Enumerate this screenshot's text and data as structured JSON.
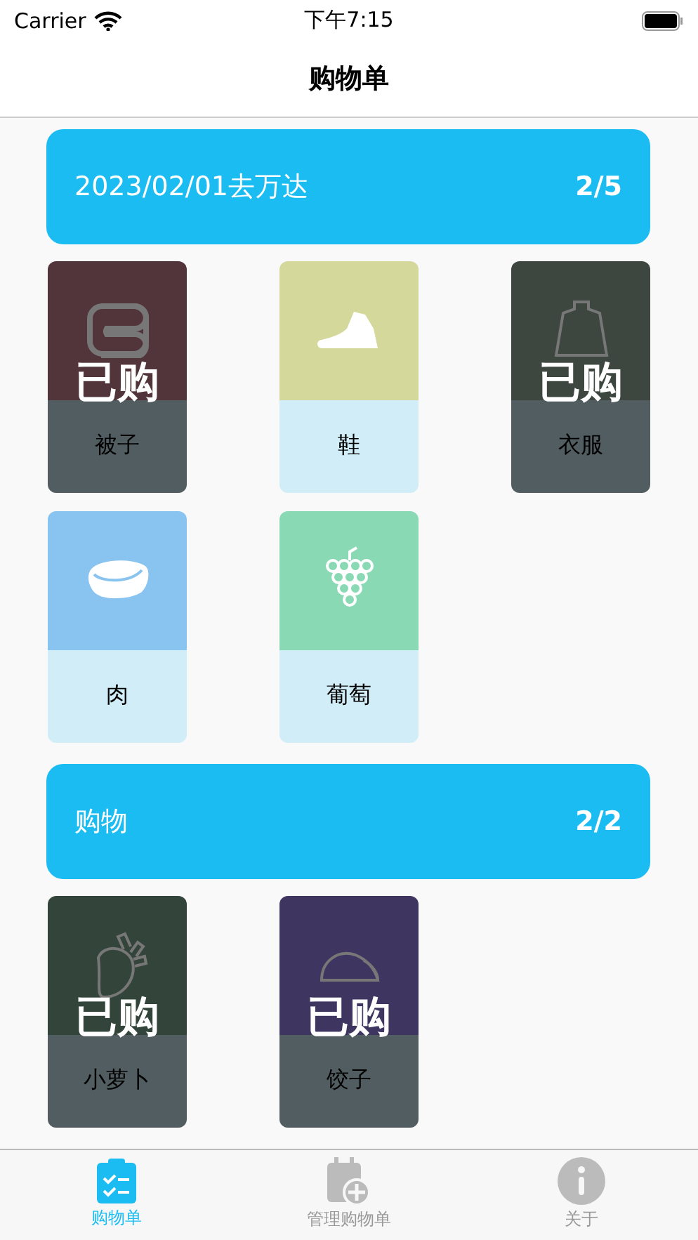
{
  "status_bar": {
    "carrier": "Carrier",
    "time": "下午7:15"
  },
  "nav": {
    "title": "购物单"
  },
  "lists": [
    {
      "title": "2023/02/01去万达",
      "count": "2/5",
      "items": [
        {
          "name": "被子",
          "kind": "quilt",
          "color": "#52353b",
          "bought": true,
          "badge": "已购"
        },
        {
          "name": "鞋",
          "kind": "shoe",
          "color": "#d5d89b",
          "bought": false
        },
        {
          "name": "衣服",
          "kind": "sweater",
          "color": "#3d4740",
          "bought": true,
          "badge": "已购"
        },
        {
          "name": "肉",
          "kind": "meat",
          "color": "#89c3f0",
          "bought": false
        },
        {
          "name": "葡萄",
          "kind": "grapes",
          "color": "#89d9b5",
          "bought": false
        }
      ]
    },
    {
      "title": "购物",
      "count": "2/2",
      "items": [
        {
          "name": "小萝卜",
          "kind": "radish",
          "color": "#33443a",
          "bought": true,
          "badge": "已购"
        },
        {
          "name": "饺子",
          "kind": "dumpling",
          "color": "#3e3560",
          "bought": true,
          "badge": "已购"
        }
      ]
    }
  ],
  "tabs": [
    {
      "label": "购物单",
      "kind": "checklist",
      "selected": true
    },
    {
      "label": "管理购物单",
      "kind": "calendar",
      "selected": false
    },
    {
      "label": "关于",
      "kind": "info",
      "selected": false
    }
  ]
}
